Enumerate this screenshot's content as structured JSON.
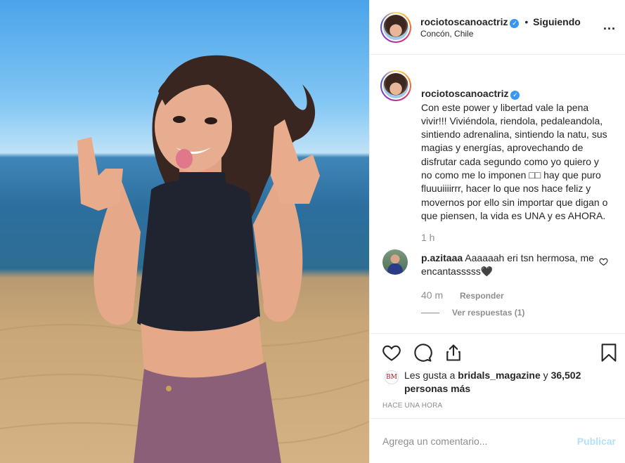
{
  "post": {
    "username": "rociotoscanoactriz",
    "verified_mark": "✓",
    "separator": "•",
    "follow_status": "Siguiendo",
    "location": "Concón, Chile",
    "more_icon": "...",
    "caption": "Con este power y libertad vale la pena vivir!!! Viviéndola, riendola, pedaleandola, sintiendo adrenalina, sintiendo la natu, sus magias y energías, aprovechando de disfrutar cada segundo como yo quiero y no como me lo imponen □□ hay que puro fluuuiiiirrr, hacer lo que nos hace feliz y movernos por ello sin importar que digan o que piensen, la vida es UNA y es AHORA.",
    "caption_time": "1 h"
  },
  "comment": {
    "username": "p.azitaaa",
    "text": "Aaaaaah eri tsn hermosa, me encantasssss🖤",
    "time": "40 m",
    "reply_label": "Responder",
    "view_replies": "Ver respuestas (1)"
  },
  "likes": {
    "badge": "BM",
    "prefix": "Les gusta a ",
    "user": "bridals_magazine",
    "middle": " y ",
    "count": "36,502 personas más",
    "post_time": "HACE UNA HORA"
  },
  "compose": {
    "placeholder": "Agrega un comentario...",
    "publish": "Publicar"
  },
  "icons": [
    "heart-icon",
    "comment-icon",
    "share-icon",
    "bookmark-icon",
    "heart-small-icon",
    "more-options-icon"
  ],
  "colors": {
    "link": "#3897f0",
    "muted": "#8e8e8e",
    "publish_disabled": "#b2dffc"
  }
}
